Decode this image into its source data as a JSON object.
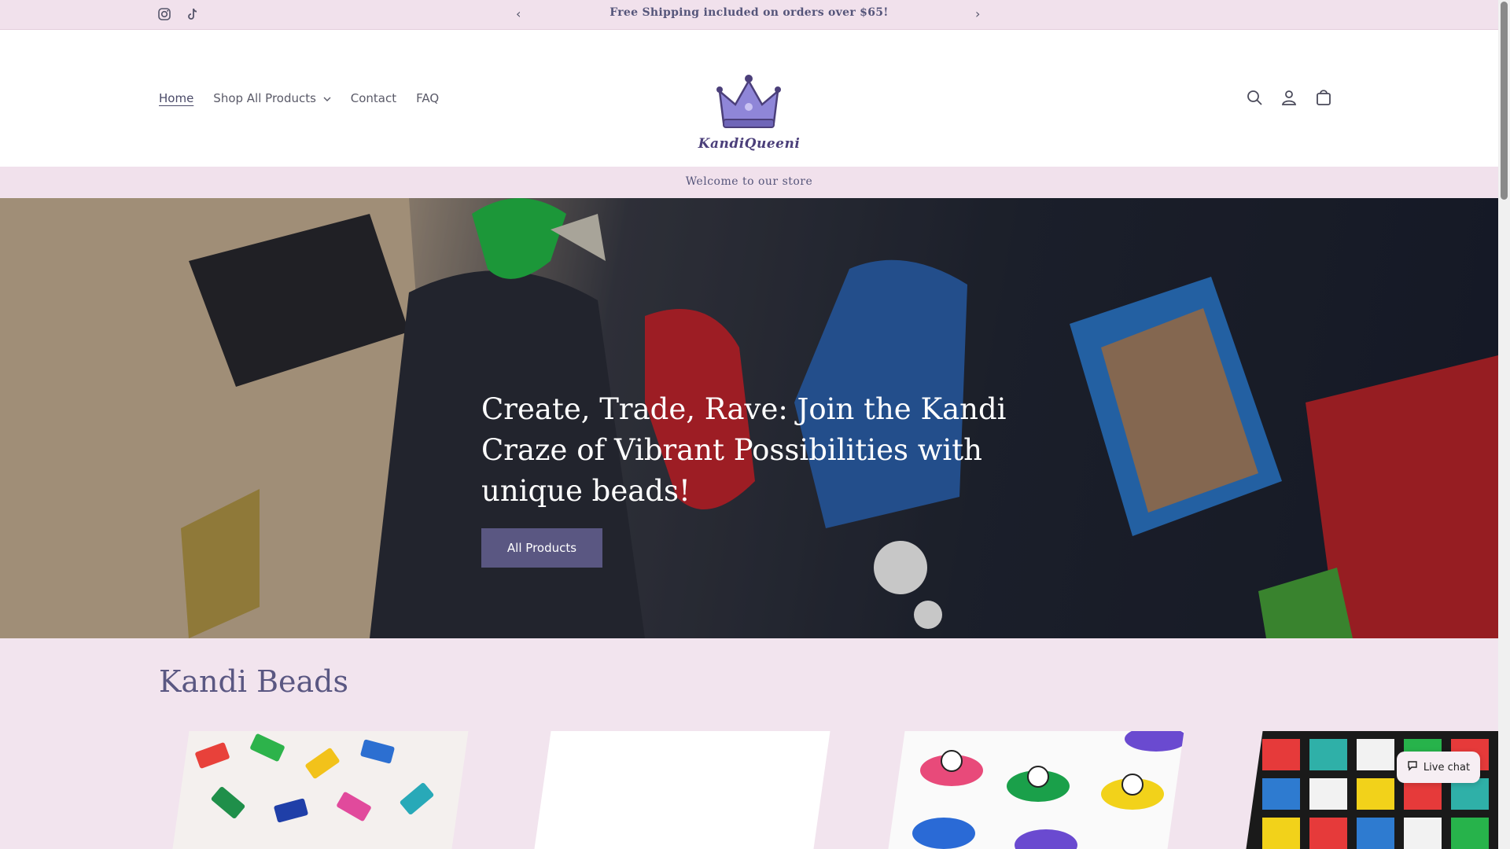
{
  "announcement": {
    "text": "Free Shipping included on orders over $65!",
    "prev_label": "‹",
    "next_label": "›"
  },
  "social": [
    "instagram-icon",
    "tiktok-icon"
  ],
  "nav": {
    "home": "Home",
    "shop": "Shop All Products",
    "contact": "Contact",
    "faq": "FAQ"
  },
  "logo": {
    "text": "KandiQueeni"
  },
  "header_icons": [
    "search-icon",
    "account-icon",
    "cart-icon"
  ],
  "welcome": "Welcome to our store",
  "hero": {
    "title": "Create, Trade, Rave: Join the Kandi Craze of Vibrant Possibilities with unique beads!",
    "button": "All Products"
  },
  "collection": {
    "title": "Kandi Beads",
    "cards": [
      {
        "name": "bead-card-rainbow-tubes"
      },
      {
        "name": "bead-card-blank"
      },
      {
        "name": "bead-card-alien-ufo"
      },
      {
        "name": "bead-card-side-quest"
      }
    ]
  },
  "chat": {
    "label": "Live chat"
  },
  "colors": {
    "accent": "#5a5782",
    "announcement_bg": "#f1e1ec",
    "page_bg": "#f2e4ee"
  }
}
